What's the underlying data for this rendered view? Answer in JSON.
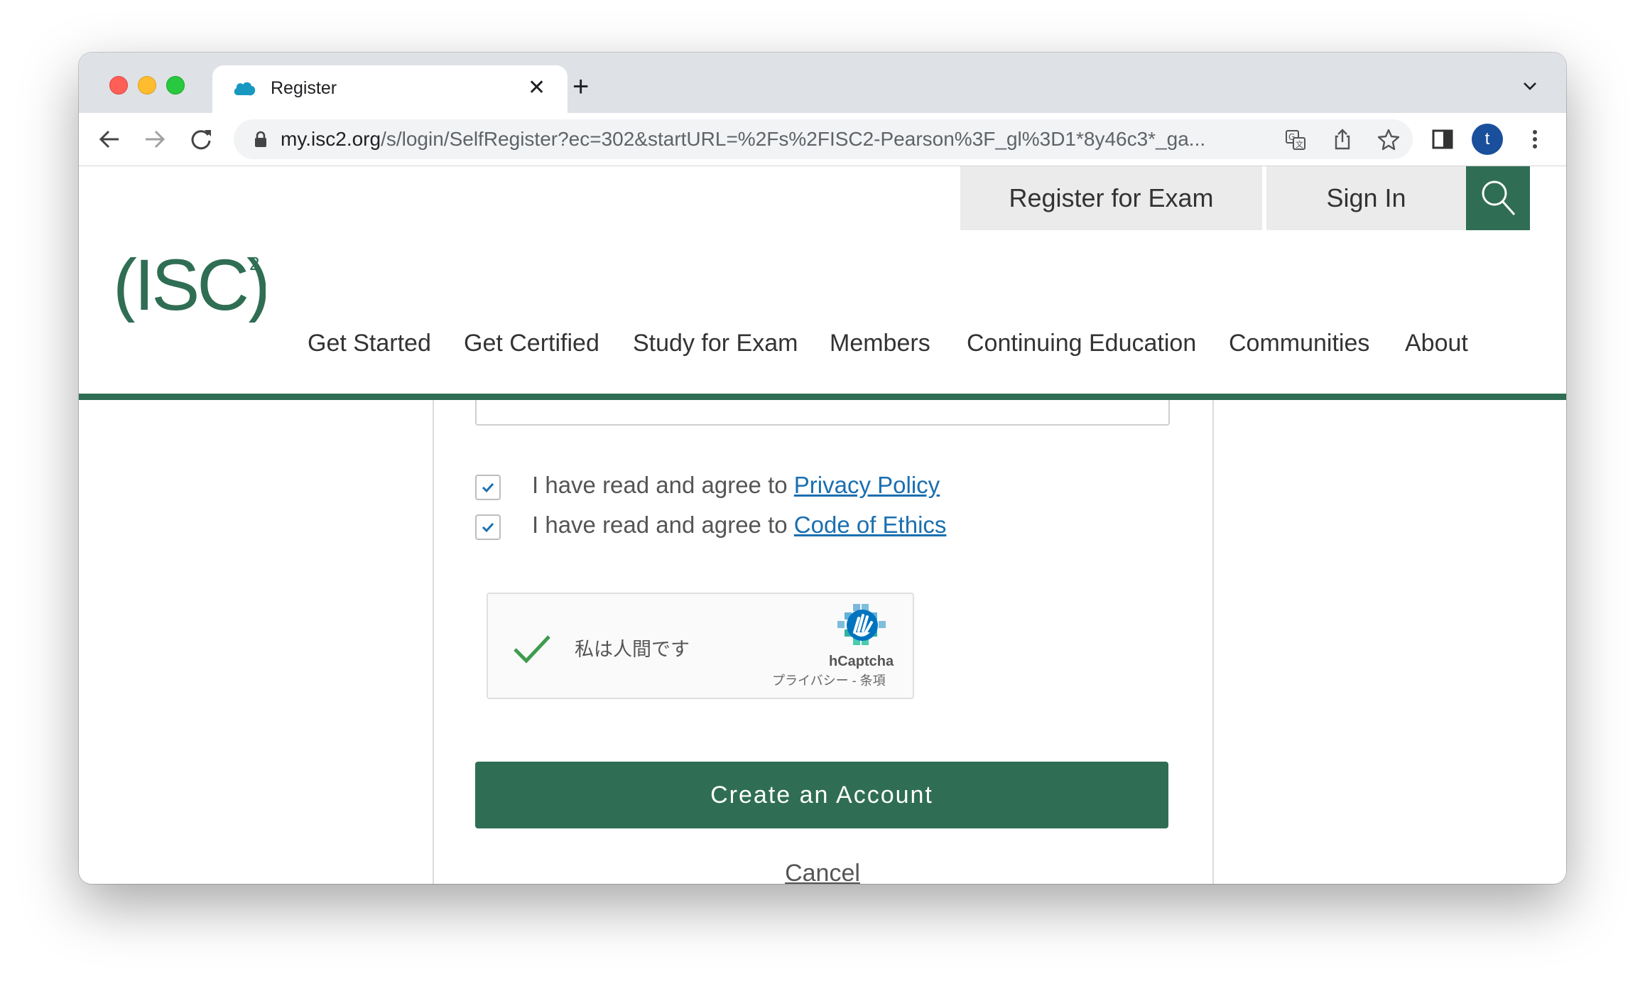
{
  "browser": {
    "tab_title": "Register",
    "tab_favicon": "salesforce-cloud-icon",
    "url_host": "my.isc2.org",
    "url_path": "/s/login/SelfRegister?ec=302&startURL=%2Fs%2FISC2-Pearson%3F_gl%3D1*8y46c3*_ga...",
    "profile_initial": "t"
  },
  "header": {
    "register_label": "Register for Exam",
    "signin_label": "Sign In",
    "logo_text": "(ISC)",
    "logo_superscript": "2",
    "brand_color": "#2f6e54",
    "nav": [
      "Get Started",
      "Get Certified",
      "Study for Exam",
      "Members",
      "Continuing Education",
      "Communities",
      "About"
    ]
  },
  "form": {
    "agree_prefix": "I have read and agree to",
    "privacy_link": "Privacy Policy",
    "ethics_link": "Code of Ethics",
    "privacy_checked": true,
    "ethics_checked": true,
    "captcha": {
      "text": "私は人間です",
      "brand": "hCaptcha",
      "links": "プライバシー - 条項",
      "verified": true
    },
    "submit_label": "Create an Account",
    "cancel_label": "Cancel"
  }
}
